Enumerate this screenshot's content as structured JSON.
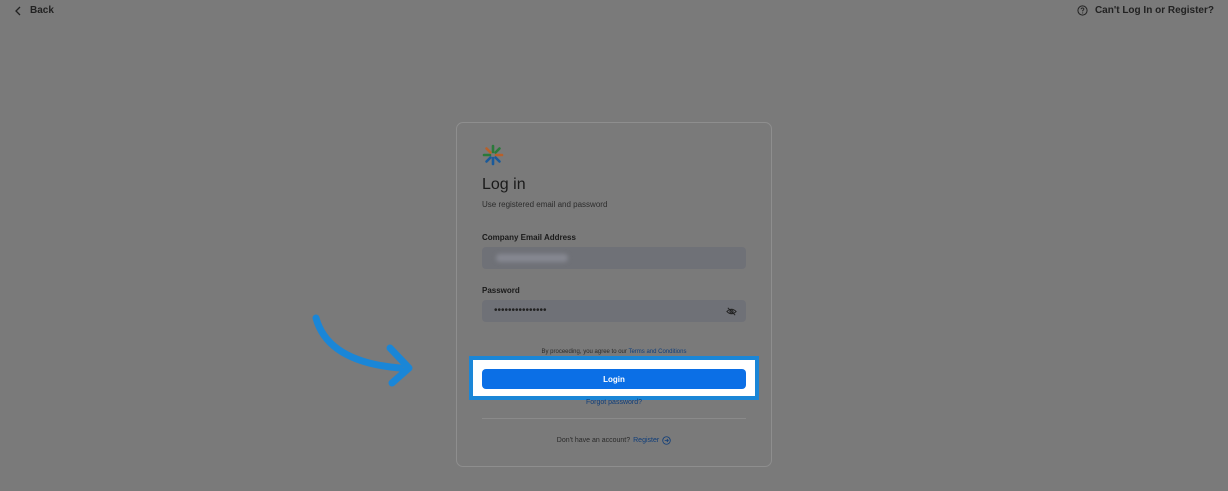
{
  "topbar": {
    "back_label": "Back",
    "help_label": "Can't Log In or Register?"
  },
  "login": {
    "title": "Log in",
    "subtitle": "Use registered email and password",
    "email_label": "Company Email Address",
    "password_label": "Password",
    "password_value": "•••••••••••••••",
    "terms_prefix": "By proceeding, you agree to our",
    "terms_link": "Terms and Conditions",
    "login_button": "Login",
    "forgot_link": "Forgot password?",
    "no_account_text": "Don't have an account?",
    "register_link": "Register"
  },
  "colors": {
    "overlay": "#7a7a7a",
    "primary_button": "#0b6fe6",
    "highlight": "#1a86d7",
    "arrow": "#1a86d7"
  },
  "icons": {
    "back": "chevron-left-icon",
    "help": "question-circle-icon",
    "eye": "eye-off-icon",
    "register": "arrow-right-circle-icon",
    "logo": "brand-logo-icon"
  }
}
